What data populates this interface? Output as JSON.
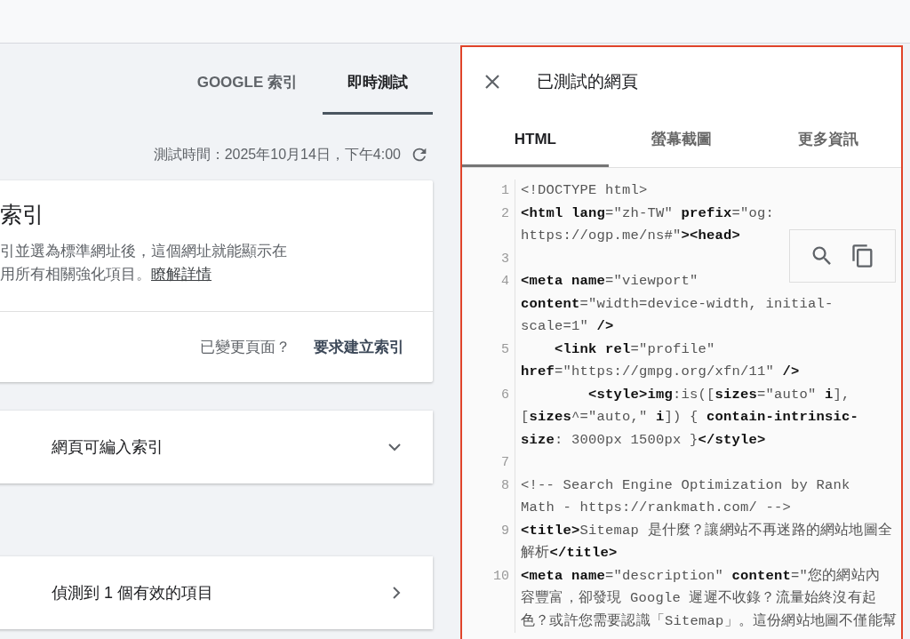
{
  "index_tabs": [
    {
      "label": "GOOGLE 索引",
      "selected": false
    },
    {
      "label": "即時測試",
      "selected": true
    }
  ],
  "test_time": "測試時間：2025年10月14日，下午4:00",
  "status_card": {
    "title": "索引",
    "description_lines": [
      "引並選為標準網址後，這個網址就能顯示在",
      "用所有相關強化項目。"
    ],
    "link": "瞭解詳情",
    "question": "已變更頁面？",
    "action": "要求建立索引"
  },
  "sections": [
    {
      "label": "網頁可編入索引",
      "kind": "expand"
    },
    {
      "label": "偵測到 1 個有效的項目",
      "kind": "navigate"
    }
  ],
  "panel": {
    "title": "已測試的網頁",
    "tabs": [
      {
        "label": "HTML",
        "selected": true
      },
      {
        "label": "螢幕截圖",
        "selected": false
      },
      {
        "label": "更多資訊",
        "selected": false
      }
    ],
    "code_lines": [
      {
        "number": "1",
        "rows": [
          "<!DOCTYPE html>"
        ]
      },
      {
        "number": "2",
        "rows": [
          "**<html** **lang**=\"zh-TW\" **prefix**=\"og:",
          "https://ogp.me/ns#\"**><head>**"
        ]
      },
      {
        "number": "3"
      },
      {
        "number": "4",
        "rows": [
          "**<meta** **name**=\"viewport\"",
          "**content**=\"width=device-width, initial-",
          "scale=1\" **/>**"
        ]
      },
      {
        "number": "5",
        "rows": [
          "    **<link** **rel**=\"profile\"",
          "**href**=\"https://gmpg.org/xfn/11\" **/>**"
        ]
      },
      {
        "number": "6",
        "rows": [
          "        **<style>img**:is([**sizes**=\"auto\" **i**],",
          "[**sizes**^=\"auto,\" **i**]) { **contain-intrinsic-**",
          "**size**: 3000px 1500px }**</style>**"
        ]
      },
      {
        "number": "7"
      },
      {
        "number": "8",
        "rows": [
          "<!-- Search Engine Optimization by Rank",
          "Math - https://rankmath.com/ -->"
        ]
      },
      {
        "number": "9",
        "rows": [
          "**<title>**Sitemap 是什麼？讓網站不再迷路的網站地圖全",
          "解析**</title>**"
        ]
      },
      {
        "number": "10",
        "rows": [
          "**<meta** **name**=\"description\" **content**=\"您的網站內",
          "容豐富，卻發現 Google 遲遲不收錄？流量始終沒有起",
          "色？或許您需要認識「Sitemap」。這份網站地圖不僅能幫"
        ]
      }
    ]
  }
}
